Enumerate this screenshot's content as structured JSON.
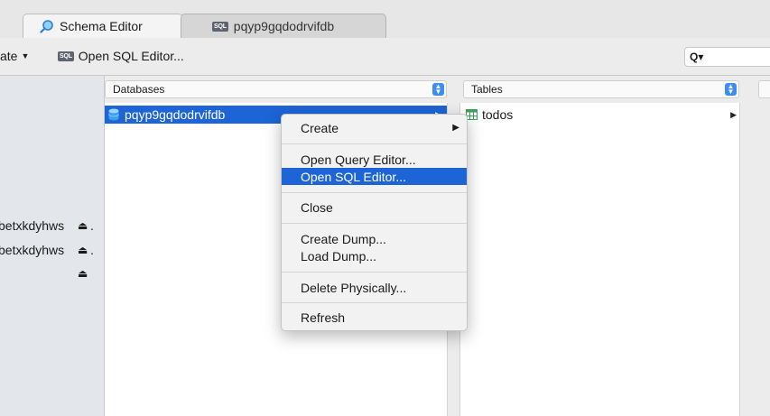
{
  "tabs": [
    {
      "label": "Schema Editor",
      "icon": "schema-editor-icon",
      "active": true
    },
    {
      "label": "pqyp9gqdodrvifdb",
      "icon": "sql-icon",
      "active": false
    }
  ],
  "toolbar": {
    "create_label": "ate",
    "sql_badge": "SQL",
    "open_sql_label": "Open SQL Editor...",
    "search_icon": "Q▾"
  },
  "sidebar": {
    "items": [
      {
        "label": "betxkdyhws",
        "ellipsis": ".",
        "eject": "⏏"
      },
      {
        "label": "betxkdyhws",
        "ellipsis": ".",
        "eject": "⏏"
      },
      {
        "label": "",
        "ellipsis": "",
        "eject": "⏏"
      }
    ]
  },
  "databases": {
    "header": "Databases",
    "items": [
      {
        "label": "pqyp9gqdodrvifdb",
        "selected": true
      }
    ]
  },
  "tables": {
    "header": "Tables",
    "items": [
      {
        "label": "todos"
      }
    ]
  },
  "context_menu": {
    "items": [
      {
        "label": "Create",
        "submenu": "▶"
      },
      {
        "label": "Open Query Editor..."
      },
      {
        "label": "Open SQL Editor..."
      },
      {
        "label": "Close"
      },
      {
        "label": "Create Dump..."
      },
      {
        "label": "Load Dump..."
      },
      {
        "label": "Delete Physically..."
      },
      {
        "label": "Refresh"
      }
    ],
    "highlighted": "Open SQL Editor..."
  },
  "colors": {
    "selection": "#1d64d6",
    "stepper": "#3c8ef5",
    "db_icon": "#3ea0f0",
    "table_icon": "#3aa35a"
  }
}
